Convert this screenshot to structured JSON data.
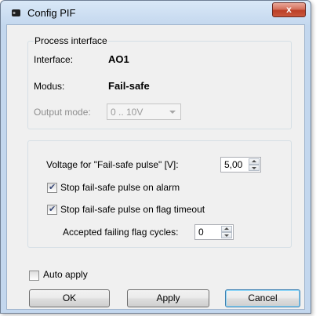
{
  "window": {
    "title": "Config PIF",
    "close_label": "x"
  },
  "process_interface": {
    "legend": "Process interface",
    "interface_label": "Interface:",
    "interface_value": "AO1",
    "modus_label": "Modus:",
    "modus_value": "Fail-safe",
    "output_mode_label": "Output mode:",
    "output_mode_value": "0 .. 10V"
  },
  "failsafe": {
    "voltage_label": "Voltage for \"Fail-safe pulse\" [V]:",
    "voltage_value": "5,00",
    "stop_on_alarm_label": "Stop fail-safe pulse on alarm",
    "stop_on_alarm_checked": true,
    "stop_on_flag_timeout_label": "Stop fail-safe pulse on flag timeout",
    "stop_on_flag_timeout_checked": true,
    "accepted_cycles_label": "Accepted failing flag cycles:",
    "accepted_cycles_value": "0"
  },
  "footer": {
    "auto_apply_label": "Auto apply",
    "auto_apply_checked": false,
    "ok_label": "OK",
    "apply_label": "Apply",
    "cancel_label": "Cancel"
  }
}
